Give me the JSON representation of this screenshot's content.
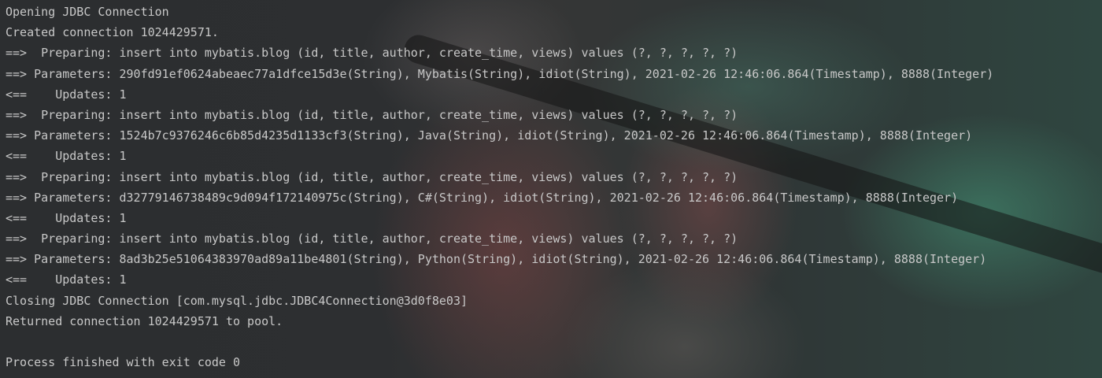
{
  "console": {
    "lines": [
      "Opening JDBC Connection",
      "Created connection 1024429571.",
      "==>  Preparing: insert into mybatis.blog (id, title, author, create_time, views) values (?, ?, ?, ?, ?)",
      "==> Parameters: 290fd91ef0624abeaec77a1dfce15d3e(String), Mybatis(String), idiot(String), 2021-02-26 12:46:06.864(Timestamp), 8888(Integer)",
      "<==    Updates: 1",
      "==>  Preparing: insert into mybatis.blog (id, title, author, create_time, views) values (?, ?, ?, ?, ?)",
      "==> Parameters: 1524b7c9376246c6b85d4235d1133cf3(String), Java(String), idiot(String), 2021-02-26 12:46:06.864(Timestamp), 8888(Integer)",
      "<==    Updates: 1",
      "==>  Preparing: insert into mybatis.blog (id, title, author, create_time, views) values (?, ?, ?, ?, ?)",
      "==> Parameters: d32779146738489c9d094f172140975c(String), C#(String), idiot(String), 2021-02-26 12:46:06.864(Timestamp), 8888(Integer)",
      "<==    Updates: 1",
      "==>  Preparing: insert into mybatis.blog (id, title, author, create_time, views) values (?, ?, ?, ?, ?)",
      "==> Parameters: 8ad3b25e51064383970ad89a11be4801(String), Python(String), idiot(String), 2021-02-26 12:46:06.864(Timestamp), 8888(Integer)",
      "<==    Updates: 1",
      "Closing JDBC Connection [com.mysql.jdbc.JDBC4Connection@3d0f8e03]",
      "Returned connection 1024429571 to pool.",
      "",
      "Process finished with exit code 0"
    ]
  },
  "colors": {
    "text": "#c8c8c8",
    "background": "#2b2d2f"
  }
}
